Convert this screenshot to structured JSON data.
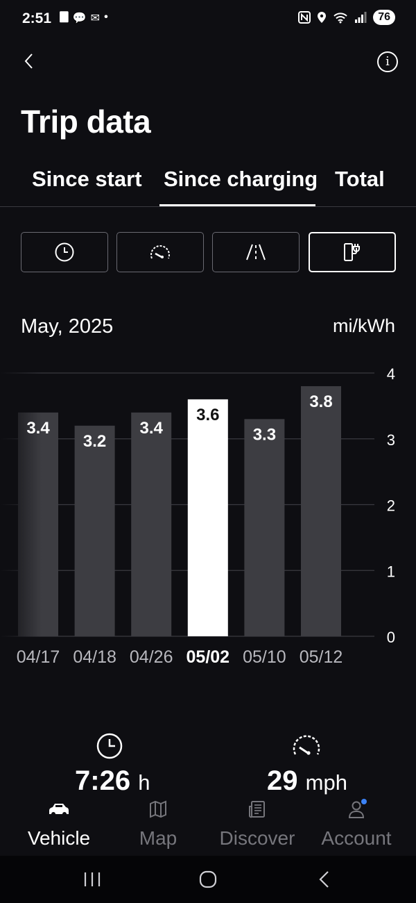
{
  "status_bar": {
    "time": "2:51",
    "left_icons": [
      "🀫",
      "💬",
      "✉",
      "•"
    ],
    "battery": "76"
  },
  "header": {
    "title": "Trip data",
    "back_icon": "chevron-left-icon",
    "info_label": "i"
  },
  "tabs": [
    {
      "label": "Since start"
    },
    {
      "label": "Since charging",
      "active": true
    },
    {
      "label": "Total"
    }
  ],
  "segments": [
    {
      "icon": "clock-icon"
    },
    {
      "icon": "speedometer-icon"
    },
    {
      "icon": "road-icon"
    },
    {
      "icon": "charging-station-icon",
      "active": true
    }
  ],
  "period": "May, 2025",
  "unit": "mi/kWh",
  "chart_data": {
    "type": "bar",
    "categories": [
      "04/17",
      "04/18",
      "04/26",
      "05/02",
      "05/10",
      "05/12"
    ],
    "values": [
      3.4,
      3.2,
      3.4,
      3.6,
      3.3,
      3.8
    ],
    "value_labels": [
      "3.4",
      "3.2",
      "3.4",
      "3.6",
      "3.3",
      "3.8"
    ],
    "highlighted": "05/02",
    "ylim": [
      0,
      4
    ],
    "yticks": [
      "0",
      "1",
      "2",
      "3",
      "4"
    ],
    "grid": true,
    "colors": {
      "bar": "#3d3d42",
      "highlight": "#ffffff",
      "grid": "#3a3a40"
    }
  },
  "stats": [
    {
      "icon": "clock-icon",
      "value": "7:26",
      "unit": "h"
    },
    {
      "icon": "speedometer-icon",
      "value": "29",
      "unit": "mph"
    }
  ],
  "bottom_nav": [
    {
      "icon": "car-icon",
      "label": "Vehicle",
      "active": true
    },
    {
      "icon": "map-icon",
      "label": "Map"
    },
    {
      "icon": "news-icon",
      "label": "Discover"
    },
    {
      "icon": "user-icon",
      "label": "Account",
      "badge": true
    }
  ]
}
